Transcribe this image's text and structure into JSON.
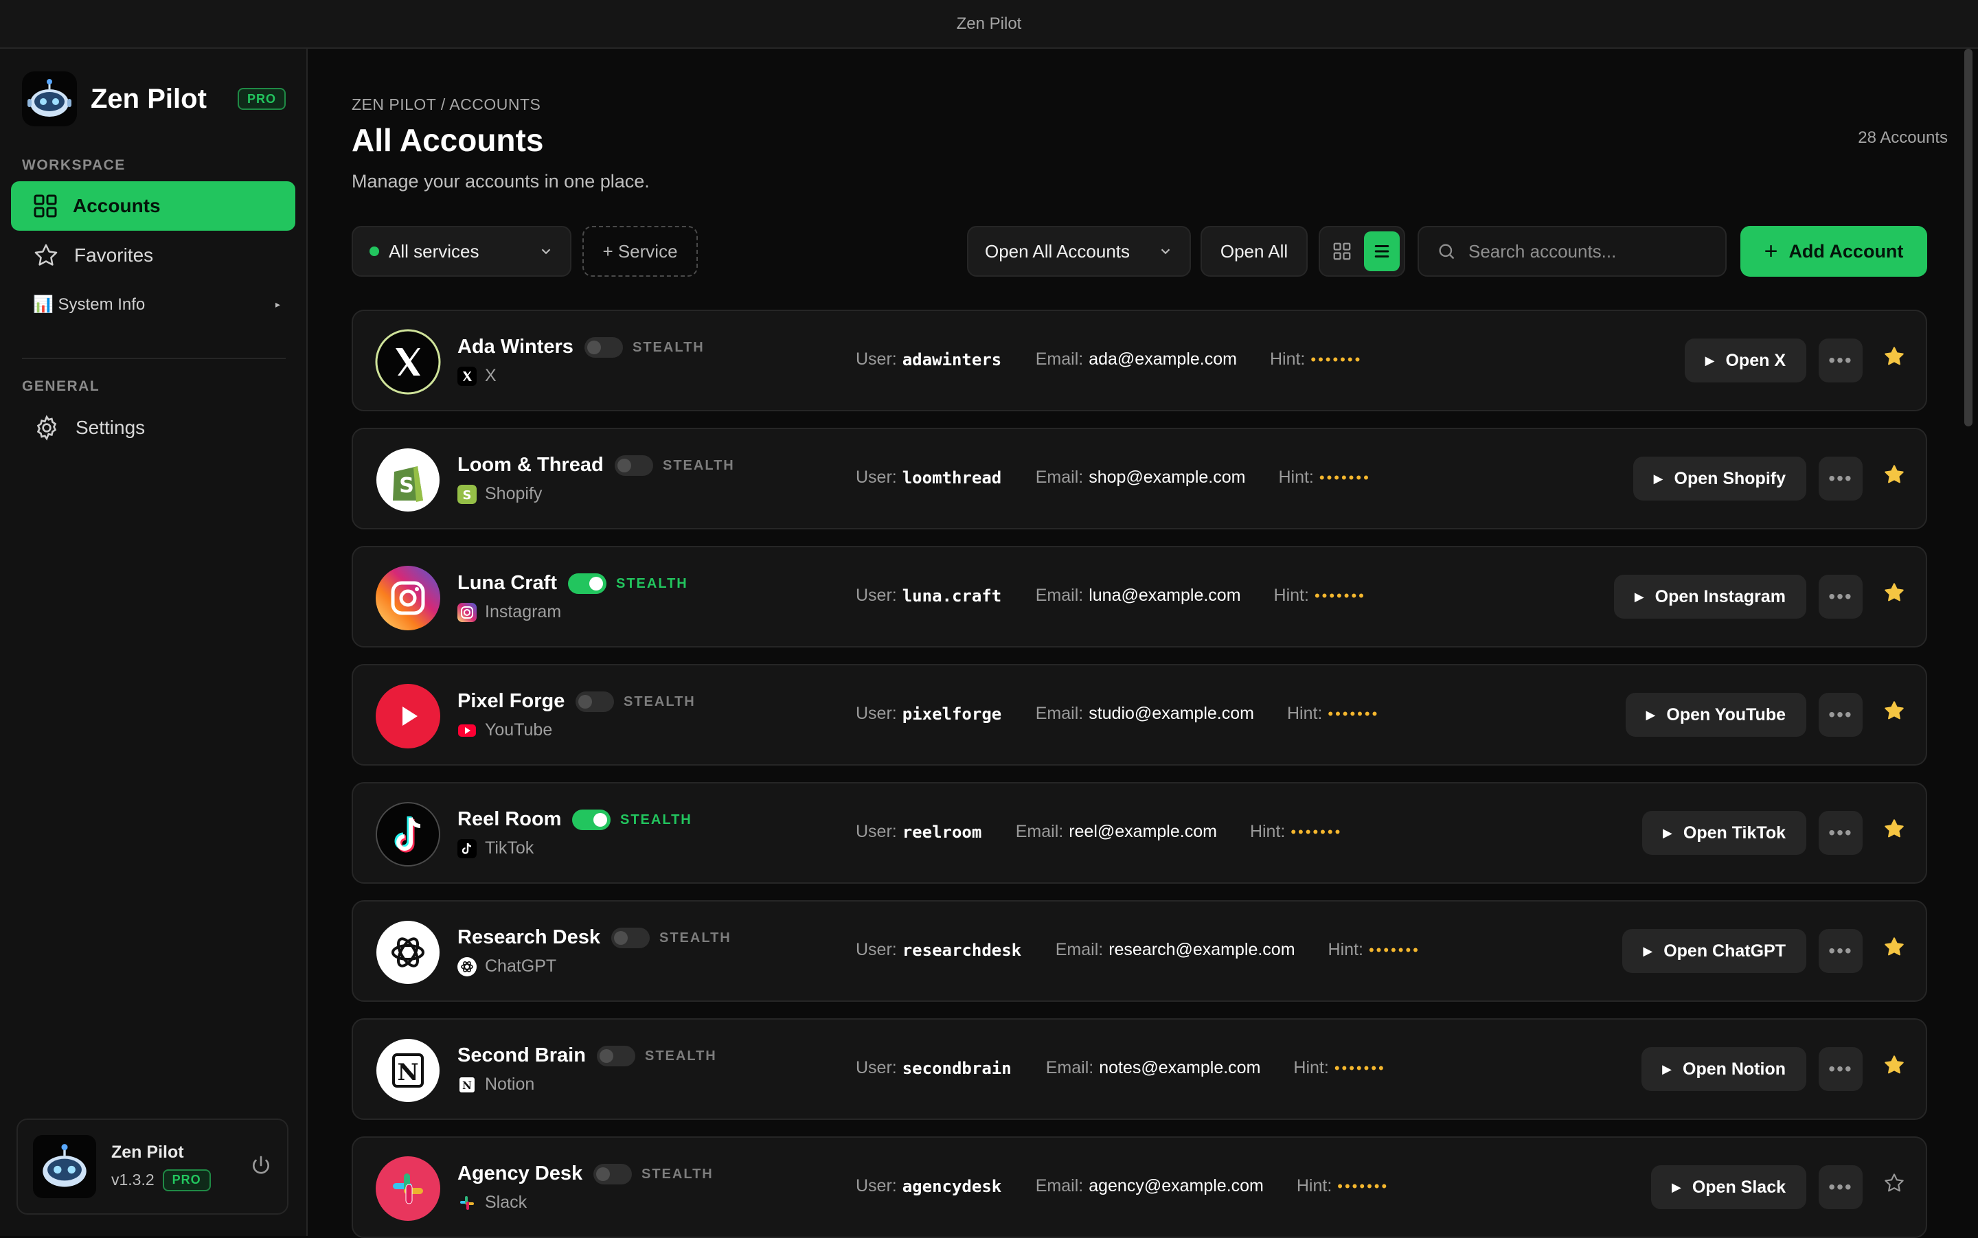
{
  "window": {
    "title": "Zen Pilot"
  },
  "brand": {
    "name": "Zen Pilot",
    "badge": "PRO"
  },
  "sidebar": {
    "workspace_label": "WORKSPACE",
    "items": [
      {
        "label": "Accounts"
      },
      {
        "label": "Favorites"
      },
      {
        "label": "📊 System Info"
      }
    ],
    "general_label": "GENERAL",
    "settings_label": "Settings"
  },
  "user_card": {
    "name": "Zen Pilot",
    "version": "v1.3.2",
    "badge": "PRO"
  },
  "header": {
    "breadcrumb": "ZEN PILOT / ACCOUNTS",
    "title": "All Accounts",
    "subtitle": "Manage your accounts in one place.",
    "count": "28 Accounts"
  },
  "toolbar": {
    "service_filter": "All services",
    "add_service": "+ Service",
    "open_all_accounts": "Open All Accounts",
    "open_all": "Open All",
    "search_placeholder": "Search accounts...",
    "add_account": "Add Account"
  },
  "labels": {
    "user": "User:",
    "email": "Email:",
    "hint": "Hint:",
    "stealth": "STEALTH"
  },
  "accounts": [
    {
      "name": "Ada Winters",
      "service": "X",
      "stealth_on": false,
      "user": "adawinters",
      "email": "ada@example.com",
      "hint": "•••••••",
      "open_label": "Open X",
      "favorite": true
    },
    {
      "name": "Loom & Thread",
      "service": "Shopify",
      "stealth_on": false,
      "user": "loomthread",
      "email": "shop@example.com",
      "hint": "•••••••",
      "open_label": "Open Shopify",
      "favorite": true
    },
    {
      "name": "Luna Craft",
      "service": "Instagram",
      "stealth_on": true,
      "user": "luna.craft",
      "email": "luna@example.com",
      "hint": "•••••••",
      "open_label": "Open Instagram",
      "favorite": true
    },
    {
      "name": "Pixel Forge",
      "service": "YouTube",
      "stealth_on": false,
      "user": "pixelforge",
      "email": "studio@example.com",
      "hint": "•••••••",
      "open_label": "Open YouTube",
      "favorite": true
    },
    {
      "name": "Reel Room",
      "service": "TikTok",
      "stealth_on": true,
      "user": "reelroom",
      "email": "reel@example.com",
      "hint": "•••••••",
      "open_label": "Open TikTok",
      "favorite": true
    },
    {
      "name": "Research Desk",
      "service": "ChatGPT",
      "stealth_on": false,
      "user": "researchdesk",
      "email": "research@example.com",
      "hint": "•••••••",
      "open_label": "Open ChatGPT",
      "favorite": true
    },
    {
      "name": "Second Brain",
      "service": "Notion",
      "stealth_on": false,
      "user": "secondbrain",
      "email": "notes@example.com",
      "hint": "•••••••",
      "open_label": "Open Notion",
      "favorite": true
    },
    {
      "name": "Agency Desk",
      "service": "Slack",
      "stealth_on": false,
      "user": "agencydesk",
      "email": "agency@example.com",
      "hint": "•••••••",
      "open_label": "Open Slack",
      "favorite": false
    }
  ],
  "colors": {
    "accent": "#22c55e",
    "star": "#f5c542",
    "hint": "#f5b72e"
  }
}
